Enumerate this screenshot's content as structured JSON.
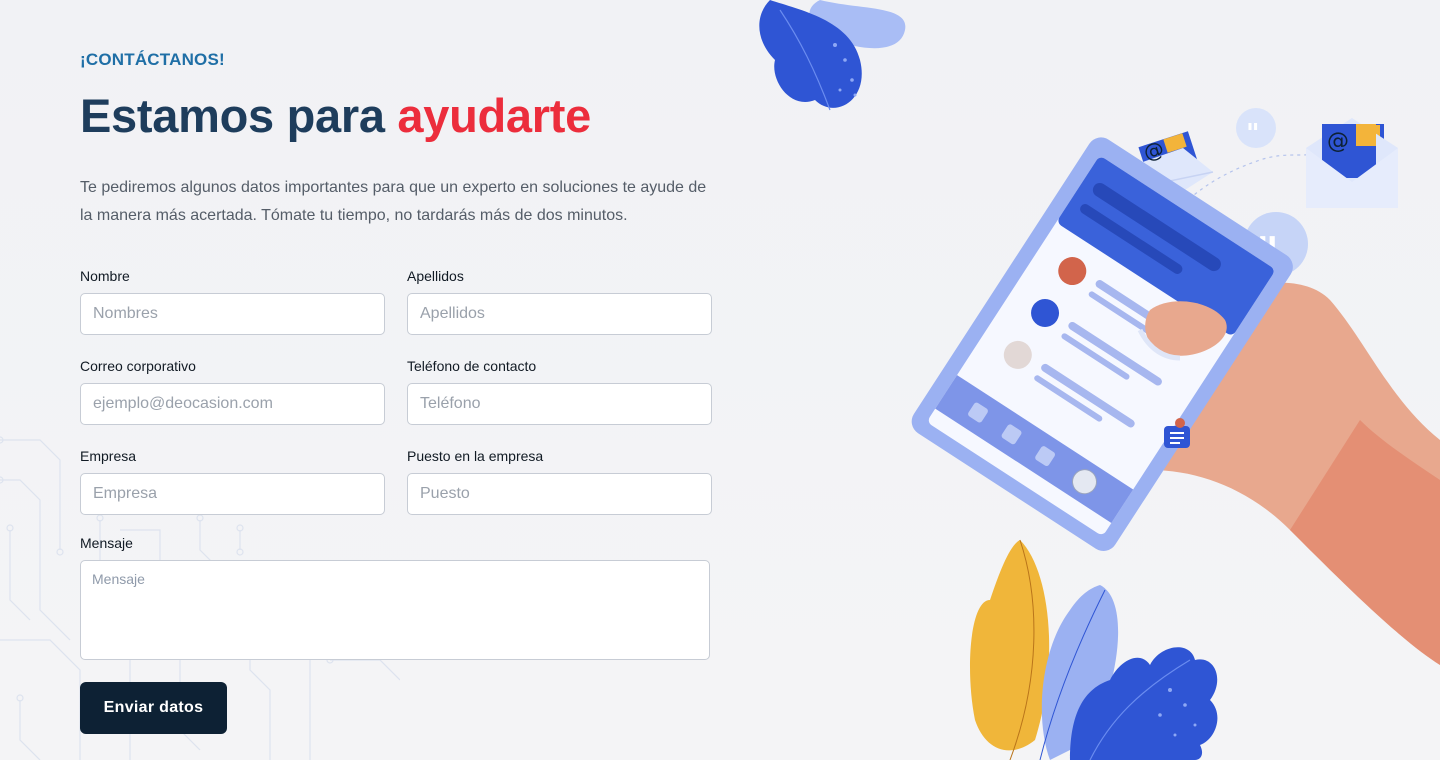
{
  "eyebrow": "¡CONTÁCTANOS!",
  "headline": {
    "main": "Estamos para",
    "accent": "ayudarte"
  },
  "intro": "Te pediremos algunos datos importantes para que un experto en soluciones te ayude de la manera más acertada. Tómate tu tiempo, no tardarás más de dos minutos.",
  "form": {
    "nombre": {
      "label": "Nombre",
      "placeholder": "Nombres"
    },
    "apellidos": {
      "label": "Apellidos",
      "placeholder": "Apellidos"
    },
    "correo": {
      "label": "Correo corporativo",
      "placeholder": "ejemplo@deocasion.com"
    },
    "telefono": {
      "label": "Teléfono de contacto",
      "placeholder": "Teléfono"
    },
    "empresa": {
      "label": "Empresa",
      "placeholder": "Empresa"
    },
    "puesto": {
      "label": "Puesto en la empresa",
      "placeholder": "Puesto"
    },
    "mensaje": {
      "label": "Mensaje",
      "placeholder": "Mensaje"
    },
    "submit_label": "Enviar datos"
  },
  "colors": {
    "eyebrow": "#1f6fa6",
    "headline": "#1e3d5c",
    "accent": "#ec2d3c",
    "button": "#0d2134"
  },
  "illustration": {
    "icons": [
      "email-at-icon",
      "email-at-icon",
      "quote-bubble-icon",
      "quote-bubble-icon",
      "chat-icon",
      "leaf-icon"
    ]
  }
}
